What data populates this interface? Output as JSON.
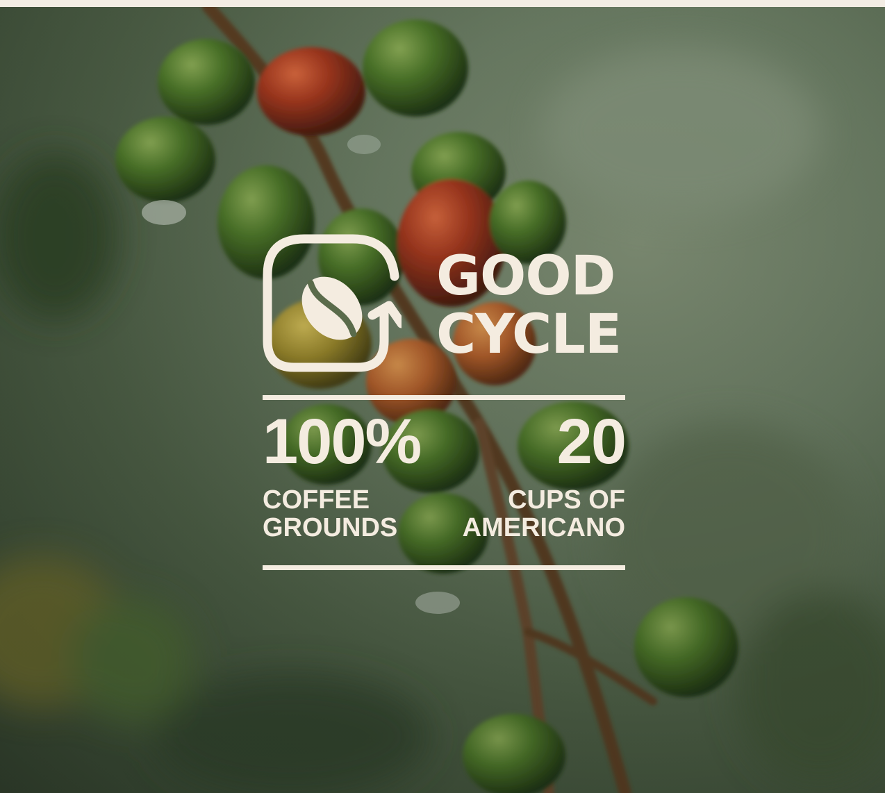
{
  "photo": {
    "subject_icon": "coffee-cherries-photo"
  },
  "brand": {
    "logo_icon": "coffee-bean-cycle-icon",
    "line1": "GOOD",
    "line2": "CYCLE"
  },
  "stats": [
    {
      "value": "100%",
      "label_line1": "COFFEE",
      "label_line2": "GROUNDS"
    },
    {
      "value": "20",
      "label_line1": "CUPS OF",
      "label_line2": "AMERICANO"
    }
  ],
  "colors": {
    "text": "#f4ece0",
    "background_strip": "#f3ede4"
  }
}
